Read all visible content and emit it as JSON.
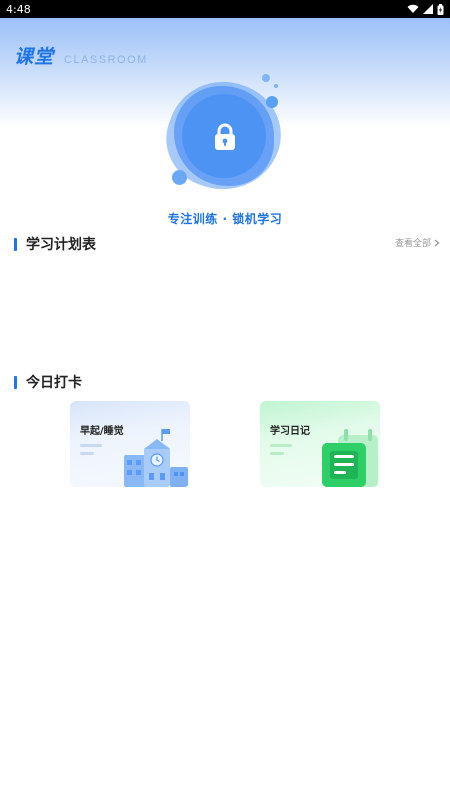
{
  "status_bar": {
    "time": "4:48"
  },
  "header": {
    "title_cn": "课堂",
    "title_en": "CLASSROOM"
  },
  "slogan": "专注训练 · 锁机学习",
  "sections": {
    "plan": {
      "title": "学习计划表",
      "view_all": "查看全部"
    },
    "checkin": {
      "title": "今日打卡",
      "cards": [
        {
          "label": "早起/睡觉",
          "icon": "school-building-icon",
          "accent": "#4c93f3"
        },
        {
          "label": "学习日记",
          "icon": "notebook-icon",
          "accent": "#22c35a"
        }
      ]
    }
  },
  "colors": {
    "primary": "#1f74e8",
    "green": "#22c35a"
  }
}
